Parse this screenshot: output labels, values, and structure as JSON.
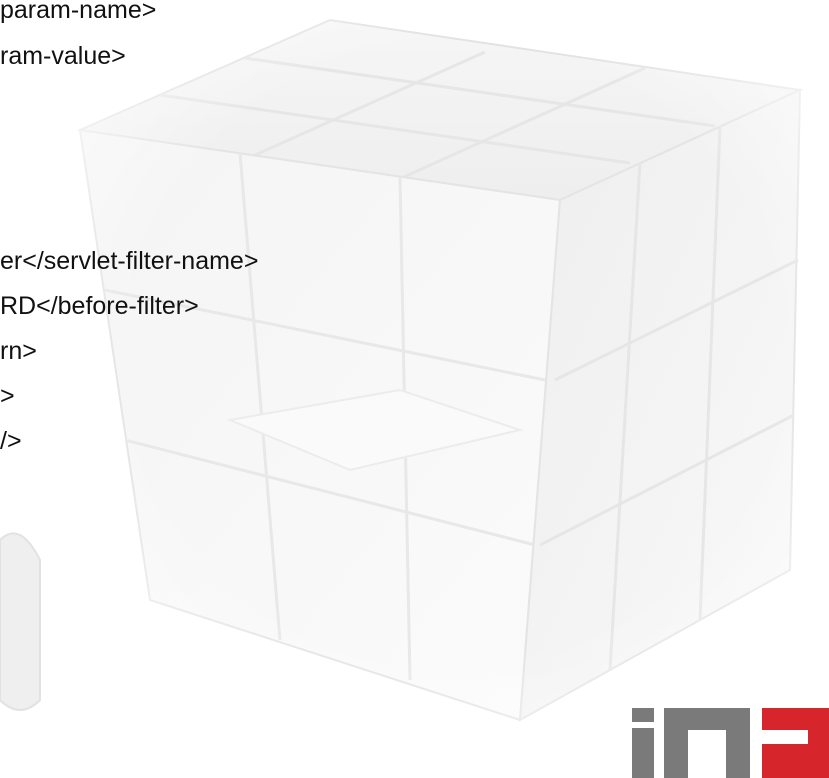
{
  "code": {
    "lines": [
      "param-name>",
      "ram-value>",
      "er</servlet-filter-name>",
      "RD</before-filter>",
      "rn>",
      ">",
      "/>"
    ]
  },
  "logo": {
    "icon": "ina-logo",
    "text": "ina",
    "colors": {
      "gray": "#7a7a7a",
      "red": "#d6262c"
    }
  },
  "background": {
    "icon": "cube-icon",
    "colors": {
      "cube_face": "#f1f1f1",
      "cube_edge": "#dcdcdc"
    }
  }
}
